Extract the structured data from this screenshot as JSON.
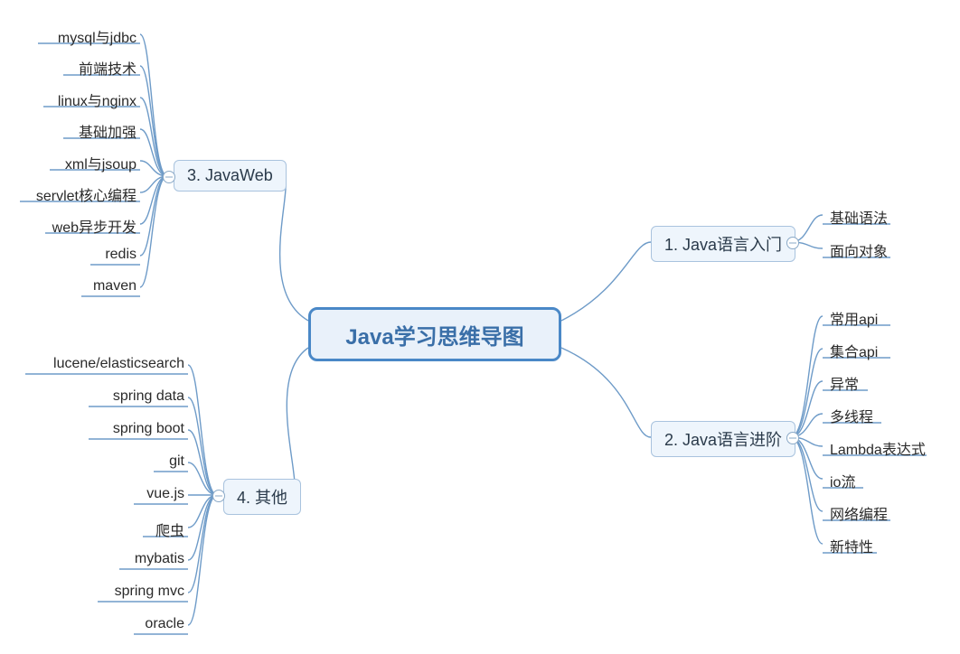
{
  "root": {
    "title": "Java学习思维导图"
  },
  "branches": {
    "b1": {
      "label": "1. Java语言入门"
    },
    "b2": {
      "label": "2. Java语言进阶"
    },
    "b3": {
      "label": "3. JavaWeb"
    },
    "b4": {
      "label": "4. 其他"
    }
  },
  "leaves": {
    "b1": [
      "基础语法",
      "面向对象"
    ],
    "b2": [
      "常用api",
      "集合api",
      "异常",
      "多线程",
      "Lambda表达式",
      "io流",
      "网络编程",
      "新特性"
    ],
    "b3": [
      "mysql与jdbc",
      "前端技术",
      "linux与nginx",
      "基础加强",
      "xml与jsoup",
      "servlet核心编程",
      "web异步开发",
      "redis",
      "maven"
    ],
    "b4": [
      "lucene/elasticsearch",
      "spring data",
      "spring boot",
      "git",
      "vue.js",
      "爬虫",
      "mybatis",
      "spring mvc",
      "oracle"
    ]
  },
  "colors": {
    "connector": "#6e9bc8",
    "branchBorder": "#a9c3de",
    "branchFill": "#eef5fc",
    "rootBorder": "#4a88c7",
    "rootFill": "#e9f1fa"
  }
}
